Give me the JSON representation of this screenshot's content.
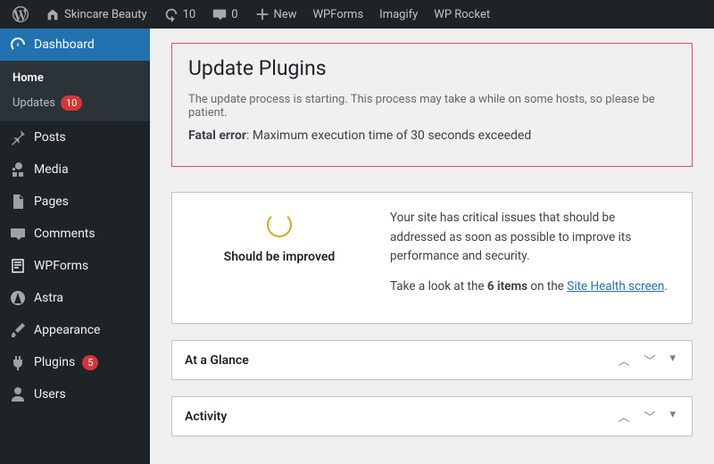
{
  "adminbar": {
    "site_name": "Skincare Beauty",
    "updates": "10",
    "comments": "0",
    "new": "New",
    "items": [
      "WPForms",
      "Imagify",
      "WP Rocket"
    ]
  },
  "sidebar": {
    "dashboard": "Dashboard",
    "submenu": {
      "home": "Home",
      "updates": "Updates",
      "updates_count": "10"
    },
    "items": [
      {
        "icon": "pin",
        "label": "Posts"
      },
      {
        "icon": "media",
        "label": "Media"
      },
      {
        "icon": "page",
        "label": "Pages"
      },
      {
        "icon": "comment",
        "label": "Comments"
      },
      {
        "icon": "form",
        "label": "WPForms"
      },
      {
        "icon": "astra",
        "label": "Astra"
      },
      {
        "icon": "brush",
        "label": "Appearance"
      },
      {
        "icon": "plugin",
        "label": "Plugins",
        "badge": "5"
      },
      {
        "icon": "user",
        "label": "Users"
      }
    ]
  },
  "error": {
    "title": "Update Plugins",
    "starting": "The update process is starting. This process may take a while on some hosts, so please be patient.",
    "fatal_label": "Fatal error",
    "fatal_msg": ": Maximum execution time of 30 seconds exceeded"
  },
  "health": {
    "status": "Should be improved",
    "msg1": "Your site has critical issues that should be addressed as soon as possible to improve its performance and security.",
    "msg2_a": "Take a look at the ",
    "items_count": "6 items",
    "msg2_b": " on the ",
    "link": "Site Health screen",
    "msg2_c": "."
  },
  "postbox": {
    "glance": "At a Glance",
    "activity": "Activity"
  }
}
